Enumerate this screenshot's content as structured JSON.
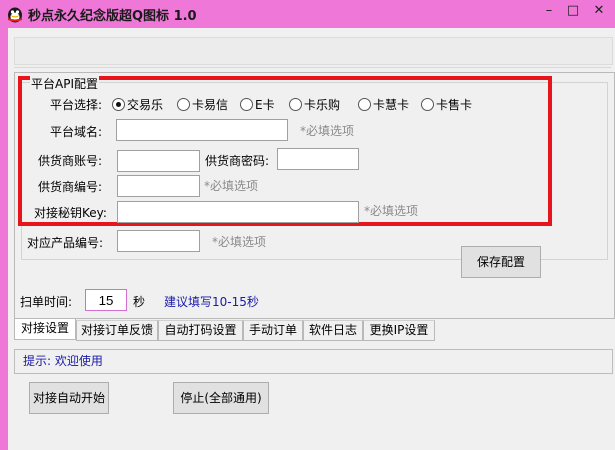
{
  "window": {
    "title": "秒点永久纪念版超Q图标 1.0",
    "controls": {
      "minimize": "–",
      "maximize": "□",
      "close": "✕"
    },
    "frame_color": "#ee77d7"
  },
  "api_config": {
    "group_title": "平台API配置",
    "platform_label": "平台选择:",
    "platforms": [
      {
        "label": "交易乐",
        "selected": true
      },
      {
        "label": "卡易信",
        "selected": false
      },
      {
        "label": "E卡",
        "selected": false
      },
      {
        "label": "卡乐购",
        "selected": false
      },
      {
        "label": "卡慧卡",
        "selected": false
      },
      {
        "label": "卡售卡",
        "selected": false
      }
    ],
    "domain_label": "平台域名:",
    "domain_value": "",
    "required_hint": "*必填选项",
    "account_label": "供货商账号:",
    "account_value": "",
    "password_label": "供货商密码:",
    "password_value": "",
    "supplier_no_label": "供货商编号:",
    "supplier_no_value": "",
    "key_label": "对接秘钥Key:",
    "key_value": "",
    "product_no_label": "对应产品编号:",
    "product_no_value": "",
    "save_button": "保存配置",
    "highlight_color": "#e8141b"
  },
  "scan": {
    "label": "扫单时间:",
    "value": "15",
    "unit": "秒",
    "suggestion": "建议填写10-15秒",
    "suggestion_color": "#1a1aa6"
  },
  "tabs": [
    {
      "label": "对接设置",
      "active": true
    },
    {
      "label": "对接订单反馈",
      "active": false
    },
    {
      "label": "自动打码设置",
      "active": false
    },
    {
      "label": "手动订单",
      "active": false
    },
    {
      "label": "软件日志",
      "active": false
    },
    {
      "label": "更换IP设置",
      "active": false
    }
  ],
  "status": {
    "text": "提示: 欢迎使用"
  },
  "actions": {
    "start_button": "对接自动开始",
    "stop_button": "停止(全部通用)"
  }
}
